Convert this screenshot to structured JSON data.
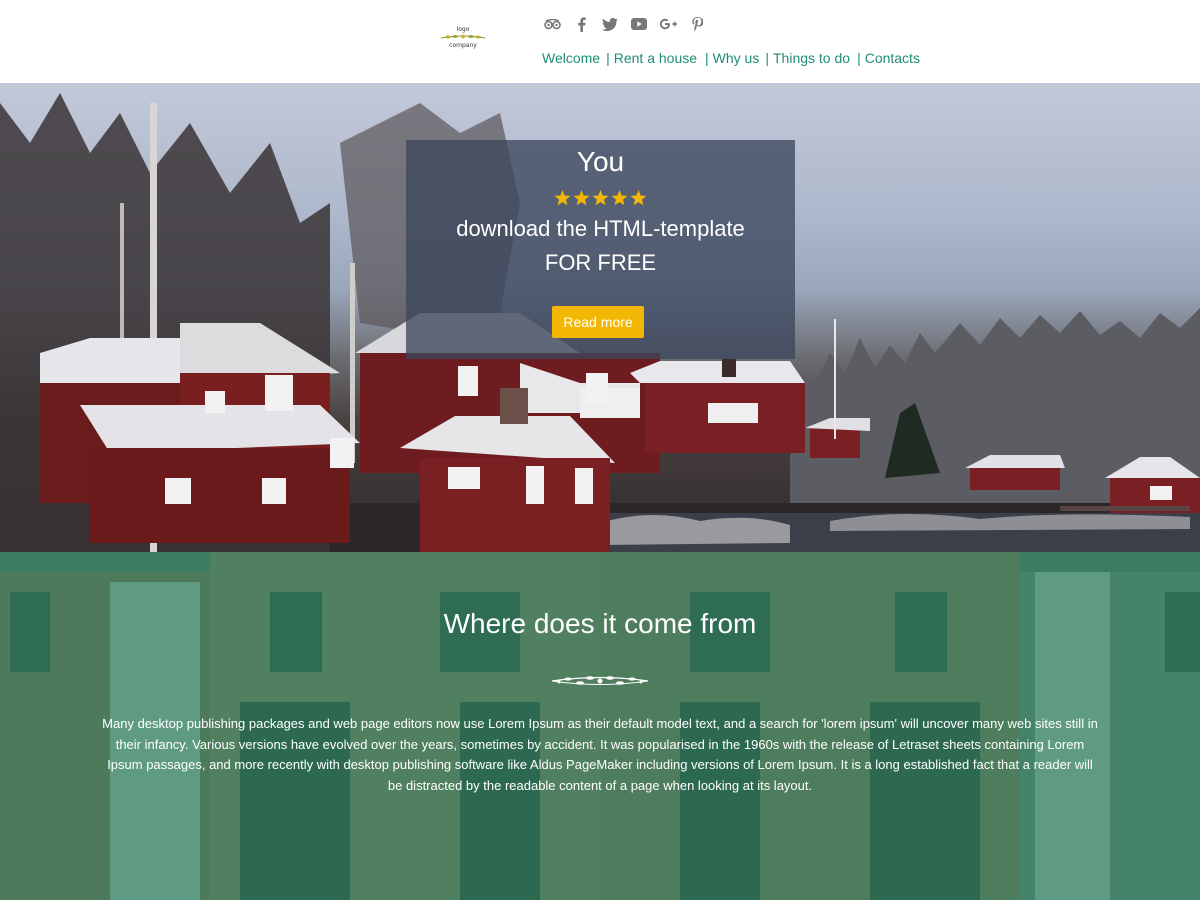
{
  "logo": {
    "line1": "logo",
    "line2": "company"
  },
  "social": [
    "tripadvisor-icon",
    "facebook-icon",
    "twitter-icon",
    "youtube-icon",
    "google-plus-icon",
    "pinterest-icon"
  ],
  "nav": {
    "items": [
      "Welcome",
      "Rent a house",
      "Why us",
      "Things to do",
      "Contacts"
    ],
    "separator": "|"
  },
  "hero": {
    "title": "You",
    "rating_stars": 5,
    "line1": "download the HTML-template",
    "line2": "FOR FREE",
    "button_label": "Read more"
  },
  "about": {
    "heading": "Where does it come from",
    "text": "Many desktop publishing packages and web page editors now use Lorem Ipsum as their default model text, and a search for 'lorem ipsum' will uncover many web sites still in their infancy. Various versions have evolved over the years, sometimes by accident. It was popularised in the 1960s with the release of Letraset sheets containing Lorem Ipsum passages, and more recently with desktop publishing software like Aldus PageMaker including versions of Lorem Ipsum. It is a long established fact that a reader will be distracted by the readable content of a page when looking at its layout."
  },
  "colors": {
    "accent": "#1e8f75",
    "button": "#f2b705",
    "star": "#f2b705",
    "about_bg": "#3a8a6c",
    "overlay": "#3c465c"
  }
}
